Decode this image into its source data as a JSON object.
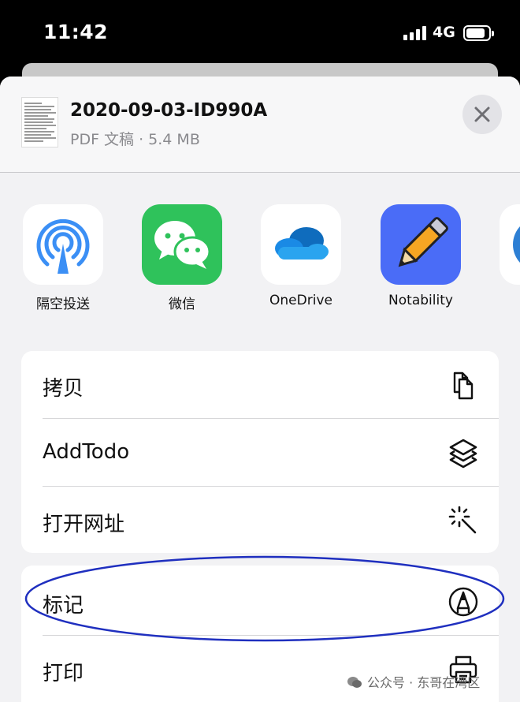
{
  "status_bar": {
    "time": "11:42",
    "network": "4G"
  },
  "file": {
    "name": "2020-09-03-ID990A",
    "meta": "PDF 文稿 · 5.4 MB"
  },
  "apps": [
    {
      "label": "隔空投送",
      "icon": "airdrop-icon"
    },
    {
      "label": "微信",
      "icon": "wechat-icon"
    },
    {
      "label": "OneDrive",
      "icon": "onedrive-icon"
    },
    {
      "label": "Notability",
      "icon": "notability-icon"
    }
  ],
  "actions_group_1": [
    {
      "label": "拷贝",
      "icon": "copy-icon"
    },
    {
      "label": "AddTodo",
      "icon": "shortcuts-icon"
    },
    {
      "label": "打开网址",
      "icon": "magic-wand-icon"
    }
  ],
  "actions_group_2": [
    {
      "label": "标记",
      "icon": "markup-icon"
    },
    {
      "label": "打印",
      "icon": "printer-icon"
    }
  ],
  "watermark": "公众号 · 东哥在湾区",
  "colors": {
    "annotation": "#1f2fbf",
    "wechat_green": "#2fc25b",
    "notability_blue": "#4a6cf7"
  }
}
